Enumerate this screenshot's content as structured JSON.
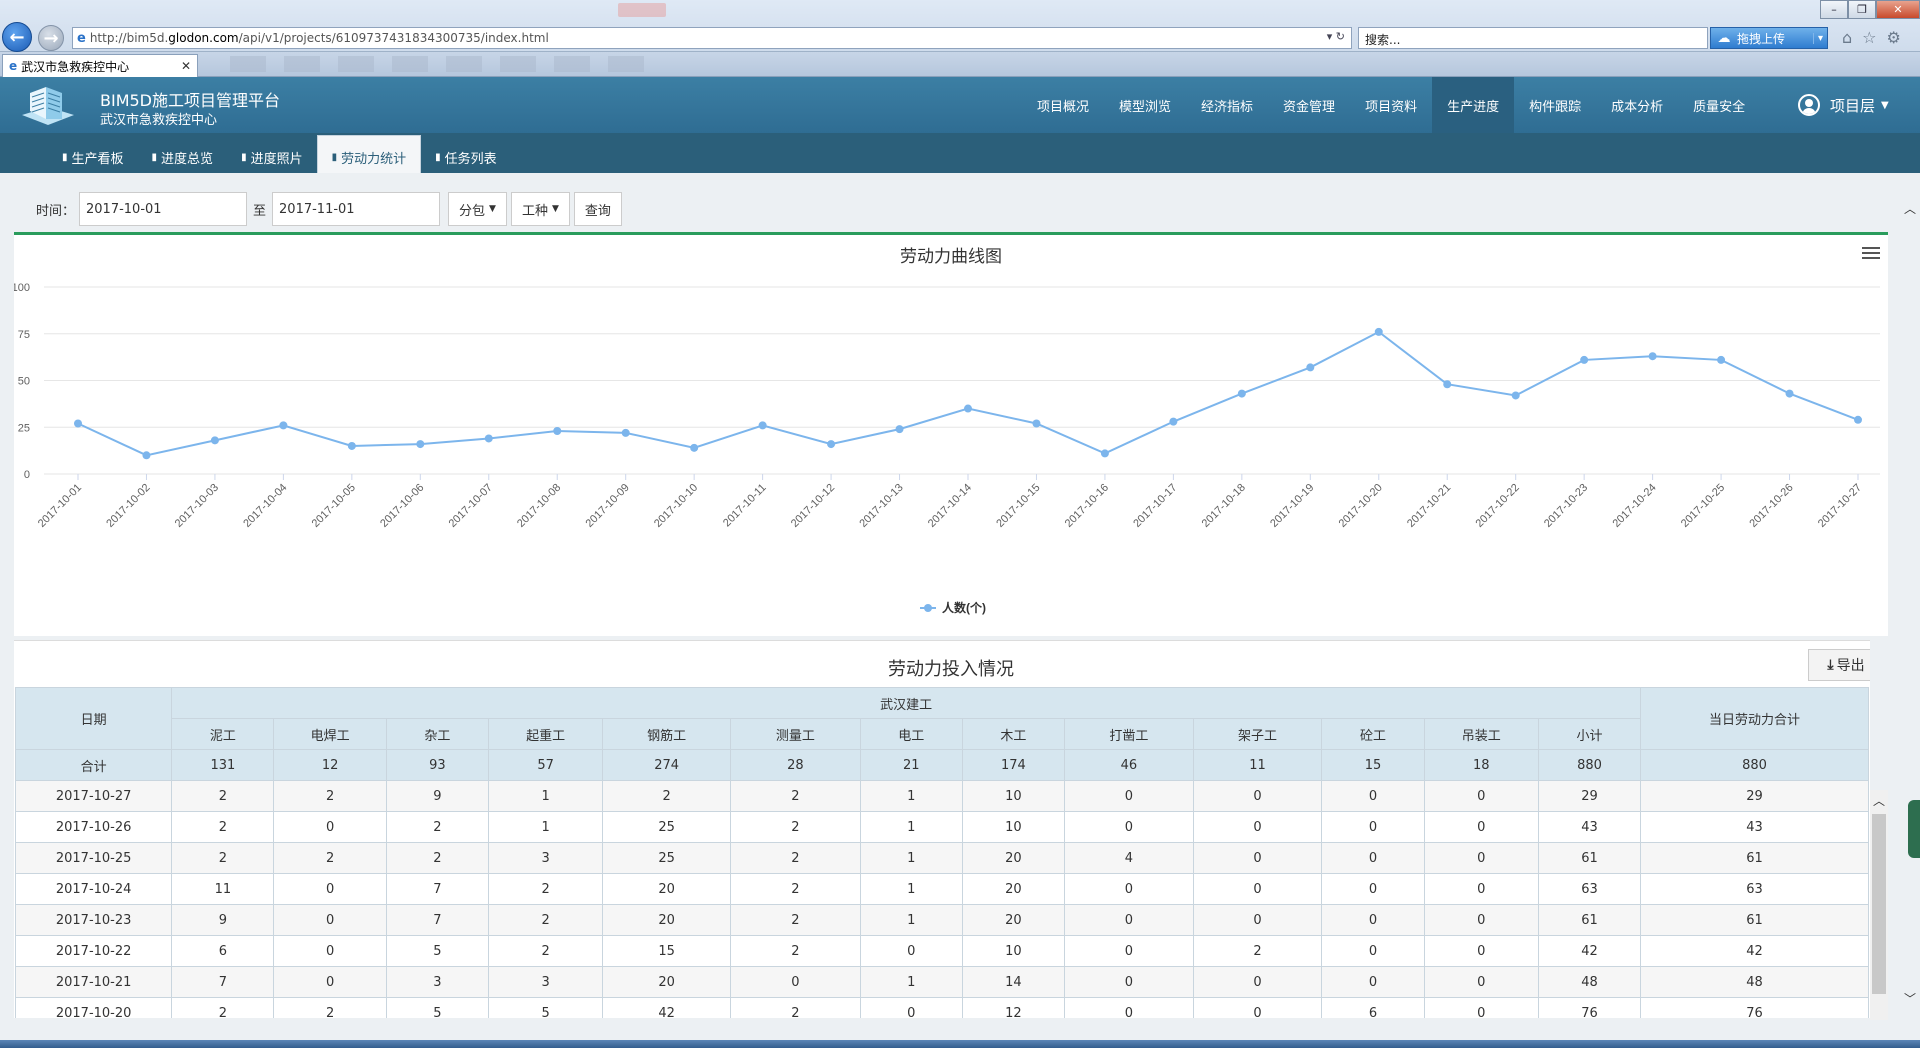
{
  "browser": {
    "url_prefix": "http://bim5d.",
    "url_domain": "glodon.com",
    "url_path": "/api/v1/projects/610973743183430073​5/index.html",
    "addr_tools": "▾ ↻",
    "search_placeholder": "搜索...",
    "upload_label": "拖拽上传",
    "tab_title": "武汉市急救疾控中心",
    "colors": {
      "chrome": "#cfdcec",
      "back": "#1b5bb4"
    }
  },
  "app": {
    "title": "BIM5D施工项目管理平台",
    "subtitle": "武汉市急救疾控中心",
    "nav": [
      "项目概况",
      "模型浏览",
      "经济指标",
      "资金管理",
      "项目资料",
      "生产进度",
      "构件跟踪",
      "成本分析",
      "质量安全"
    ],
    "nav_active": "生产进度",
    "user_label": "项目层",
    "sub_nav": [
      "生产看板",
      "进度总览",
      "进度照片",
      "劳动力统计",
      "任务列表"
    ],
    "sub_nav_active": "劳动力统计",
    "colors": {
      "header": "#3c7fa4",
      "subnav": "#2b5f7a",
      "accent": "#2a9c5c"
    }
  },
  "filter": {
    "time_label": "时间：",
    "start": "2017-10-01",
    "to_label": "至",
    "end": "2017-11-01",
    "subcontract_label": "分包",
    "worktype_label": "工种",
    "query_label": "查询"
  },
  "chart_data": {
    "type": "line",
    "title": "劳动力曲线图",
    "x": [
      "2017-10-01",
      "2017-10-02",
      "2017-10-03",
      "2017-10-04",
      "2017-10-05",
      "2017-10-06",
      "2017-10-07",
      "2017-10-08",
      "2017-10-09",
      "2017-10-10",
      "2017-10-11",
      "2017-10-12",
      "2017-10-13",
      "2017-10-14",
      "2017-10-15",
      "2017-10-16",
      "2017-10-17",
      "2017-10-18",
      "2017-10-19",
      "2017-10-20",
      "2017-10-21",
      "2017-10-22",
      "2017-10-23",
      "2017-10-24",
      "2017-10-25",
      "2017-10-26",
      "2017-10-27"
    ],
    "series": [
      {
        "name": "人数(个)",
        "color": "#7cb5ec",
        "values": [
          27,
          10,
          18,
          26,
          15,
          16,
          19,
          23,
          22,
          14,
          26,
          16,
          24,
          35,
          27,
          11,
          28,
          43,
          57,
          76,
          48,
          42,
          61,
          63,
          61,
          43,
          29
        ]
      }
    ],
    "yticks": [
      0,
      25,
      50,
      75,
      100
    ],
    "ylim": [
      0,
      100
    ],
    "grid": true,
    "legend": "bottom-center"
  },
  "table": {
    "title": "劳动力投入情况",
    "export_label": "导出",
    "date_header": "日期",
    "group_header": "武汉建工",
    "total_header": "当日劳动力合计",
    "columns": [
      "泥工",
      "电焊工",
      "杂工",
      "起重工",
      "钢筋工",
      "测量工",
      "电工",
      "木工",
      "打凿工",
      "架子工",
      "砼工",
      "吊装工",
      "小计"
    ],
    "total_row": {
      "label": "合计",
      "values": [
        131,
        12,
        93,
        57,
        274,
        28,
        21,
        174,
        46,
        11,
        15,
        18,
        880
      ],
      "sum": 880
    },
    "rows": [
      {
        "date": "2017-10-27",
        "values": [
          2,
          2,
          9,
          1,
          2,
          2,
          1,
          10,
          0,
          0,
          0,
          0,
          29
        ],
        "sum": 29
      },
      {
        "date": "2017-10-26",
        "values": [
          2,
          0,
          2,
          1,
          25,
          2,
          1,
          10,
          0,
          0,
          0,
          0,
          43
        ],
        "sum": 43
      },
      {
        "date": "2017-10-25",
        "values": [
          2,
          2,
          2,
          3,
          25,
          2,
          1,
          20,
          4,
          0,
          0,
          0,
          61
        ],
        "sum": 61
      },
      {
        "date": "2017-10-24",
        "values": [
          11,
          0,
          7,
          2,
          20,
          2,
          1,
          20,
          0,
          0,
          0,
          0,
          63
        ],
        "sum": 63
      },
      {
        "date": "2017-10-23",
        "values": [
          9,
          0,
          7,
          2,
          20,
          2,
          1,
          20,
          0,
          0,
          0,
          0,
          61
        ],
        "sum": 61
      },
      {
        "date": "2017-10-22",
        "values": [
          6,
          0,
          5,
          2,
          15,
          2,
          0,
          10,
          0,
          2,
          0,
          0,
          42
        ],
        "sum": 42
      },
      {
        "date": "2017-10-21",
        "values": [
          7,
          0,
          3,
          3,
          20,
          0,
          1,
          14,
          0,
          0,
          0,
          0,
          48
        ],
        "sum": 48
      },
      {
        "date": "2017-10-20",
        "values": [
          2,
          2,
          5,
          5,
          42,
          2,
          0,
          12,
          0,
          0,
          6,
          0,
          76
        ],
        "sum": 76
      }
    ]
  }
}
